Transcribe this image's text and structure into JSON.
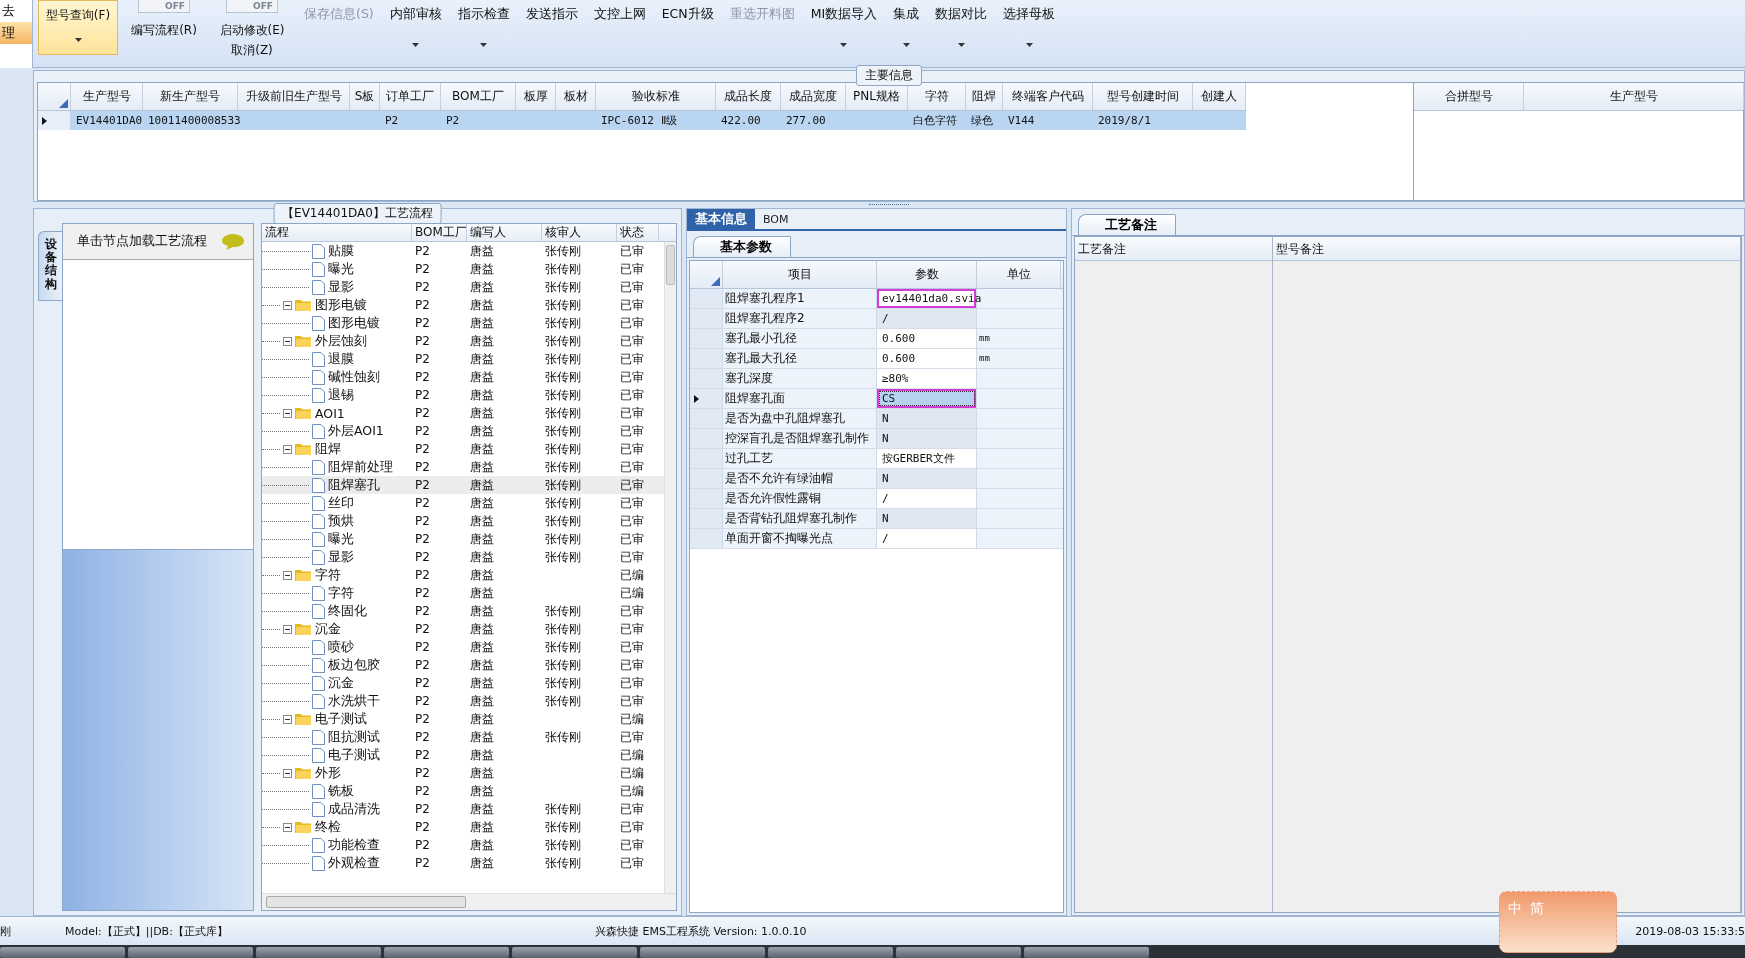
{
  "sidebar": {
    "items": [
      {
        "label": "去",
        "selected": false
      },
      {
        "label": "理",
        "selected": true
      }
    ]
  },
  "toolbar": {
    "items": [
      {
        "kind": "big",
        "label": "型号查询(F)",
        "active": true,
        "dropdown": true
      },
      {
        "kind": "toggle",
        "switch": "OFF",
        "on": false,
        "label": "编写流程(R)"
      },
      {
        "kind": "toggle",
        "switch": "OFF",
        "on": false,
        "label": "启动修改(E)",
        "sublabel": "取消(Z)"
      },
      {
        "kind": "text",
        "label": "保存信息(S)",
        "disabled": true,
        "dropdown": false
      },
      {
        "kind": "text",
        "label": "内部审核",
        "disabled": false,
        "dropdown": true
      },
      {
        "kind": "text",
        "label": "指示检查",
        "disabled": false,
        "dropdown": true
      },
      {
        "kind": "text",
        "label": "发送指示",
        "disabled": false,
        "dropdown": false
      },
      {
        "kind": "text",
        "label": "文控上网",
        "disabled": false,
        "dropdown": false
      },
      {
        "kind": "text",
        "label": "ECN升级",
        "disabled": false,
        "dropdown": false
      },
      {
        "kind": "text",
        "label": "重选开料图",
        "disabled": true,
        "dropdown": false
      },
      {
        "kind": "text",
        "label": "MI数据导入",
        "disabled": false,
        "dropdown": true
      },
      {
        "kind": "text",
        "label": "集成",
        "disabled": false,
        "dropdown": true
      },
      {
        "kind": "text",
        "label": "数据对比",
        "disabled": false,
        "dropdown": true
      },
      {
        "kind": "text",
        "label": "选择母板",
        "disabled": false,
        "dropdown": true
      }
    ]
  },
  "main_info": {
    "title": "主要信息",
    "columns": [
      "生产型号",
      "新生产型号",
      "升级前旧生产型号",
      "S板",
      "订单工厂",
      "BOM工厂",
      "板厚",
      "板材",
      "验收标准",
      "成品长度",
      "成品宽度",
      "PNL规格",
      "字符",
      "阻焊",
      "终端客户代码",
      "型号创建时间",
      "创建人"
    ],
    "rows": [
      {
        "selected": true,
        "cells": [
          "EV14401DA0",
          "10011400008533",
          null,
          null,
          "P2",
          "P2",
          null,
          null,
          "IPC-6012 Ⅱ级",
          "422.00",
          "277.00",
          null,
          "白色字符",
          "绿色",
          "V144",
          "2019/8/1",
          null
        ]
      }
    ],
    "side_columns": [
      "合拼型号",
      "生产型号"
    ]
  },
  "process": {
    "title": "【EV14401DA0】工艺流程",
    "side_tab": "设备结构",
    "hint": "单击节点加载工艺流程",
    "columns": [
      "流程",
      "BOM工厂",
      "编写人",
      "核审人",
      "状态"
    ],
    "nodes": [
      {
        "kind": "leaf",
        "name": "贴膜",
        "bom": "P2",
        "writer": "唐益",
        "reviewer": "张传刚",
        "status": "已审",
        "selected": false
      },
      {
        "kind": "leaf",
        "name": "曝光",
        "bom": "P2",
        "writer": "唐益",
        "reviewer": "张传刚",
        "status": "已审",
        "selected": false
      },
      {
        "kind": "leaf",
        "name": "显影",
        "bom": "P2",
        "writer": "唐益",
        "reviewer": "张传刚",
        "status": "已审",
        "selected": false
      },
      {
        "kind": "folder",
        "name": "图形电镀",
        "bom": "P2",
        "writer": "唐益",
        "reviewer": "张传刚",
        "status": "已审",
        "selected": false,
        "expanded": true,
        "children": [
          {
            "kind": "leaf",
            "name": "图形电镀",
            "bom": "P2",
            "writer": "唐益",
            "reviewer": "张传刚",
            "status": "已审",
            "selected": false
          }
        ]
      },
      {
        "kind": "folder",
        "name": "外层蚀刻",
        "bom": "P2",
        "writer": "唐益",
        "reviewer": "张传刚",
        "status": "已审",
        "selected": false,
        "expanded": true,
        "children": [
          {
            "kind": "leaf",
            "name": "退膜",
            "bom": "P2",
            "writer": "唐益",
            "reviewer": "张传刚",
            "status": "已审",
            "selected": false
          },
          {
            "kind": "leaf",
            "name": "碱性蚀刻",
            "bom": "P2",
            "writer": "唐益",
            "reviewer": "张传刚",
            "status": "已审",
            "selected": false
          },
          {
            "kind": "leaf",
            "name": "退锡",
            "bom": "P2",
            "writer": "唐益",
            "reviewer": "张传刚",
            "status": "已审",
            "selected": false
          }
        ]
      },
      {
        "kind": "folder",
        "name": "AOI1",
        "bom": "P2",
        "writer": "唐益",
        "reviewer": "张传刚",
        "status": "已审",
        "selected": false,
        "expanded": true,
        "children": [
          {
            "kind": "leaf",
            "name": "外层AOI1",
            "bom": "P2",
            "writer": "唐益",
            "reviewer": "张传刚",
            "status": "已审",
            "selected": false
          }
        ]
      },
      {
        "kind": "folder",
        "name": "阻焊",
        "bom": "P2",
        "writer": "唐益",
        "reviewer": "张传刚",
        "status": "已审",
        "selected": false,
        "expanded": true,
        "children": [
          {
            "kind": "leaf",
            "name": "阻焊前处理",
            "bom": "P2",
            "writer": "唐益",
            "reviewer": "张传刚",
            "status": "已审",
            "selected": false
          },
          {
            "kind": "leaf",
            "name": "阻焊塞孔",
            "bom": "P2",
            "writer": "唐益",
            "reviewer": "张传刚",
            "status": "已审",
            "selected": true
          },
          {
            "kind": "leaf",
            "name": "丝印",
            "bom": "P2",
            "writer": "唐益",
            "reviewer": "张传刚",
            "status": "已审",
            "selected": false
          },
          {
            "kind": "leaf",
            "name": "预烘",
            "bom": "P2",
            "writer": "唐益",
            "reviewer": "张传刚",
            "status": "已审",
            "selected": false
          },
          {
            "kind": "leaf",
            "name": "曝光",
            "bom": "P2",
            "writer": "唐益",
            "reviewer": "张传刚",
            "status": "已审",
            "selected": false
          },
          {
            "kind": "leaf",
            "name": "显影",
            "bom": "P2",
            "writer": "唐益",
            "reviewer": "张传刚",
            "status": "已审",
            "selected": false
          }
        ]
      },
      {
        "kind": "folder",
        "name": "字符",
        "bom": "P2",
        "writer": "唐益",
        "status": "已编",
        "selected": false,
        "expanded": true,
        "children": [
          {
            "kind": "leaf",
            "name": "字符",
            "bom": "P2",
            "writer": "唐益",
            "status": "已编",
            "selected": false
          },
          {
            "kind": "leaf",
            "name": "终固化",
            "bom": "P2",
            "writer": "唐益",
            "reviewer": "张传刚",
            "status": "已审",
            "selected": false
          }
        ]
      },
      {
        "kind": "folder",
        "name": "沉金",
        "bom": "P2",
        "writer": "唐益",
        "reviewer": "张传刚",
        "status": "已审",
        "selected": false,
        "expanded": true,
        "children": [
          {
            "kind": "leaf",
            "name": "喷砂",
            "bom": "P2",
            "writer": "唐益",
            "reviewer": "张传刚",
            "status": "已审",
            "selected": false
          },
          {
            "kind": "leaf",
            "name": "板边包胶",
            "bom": "P2",
            "writer": "唐益",
            "reviewer": "张传刚",
            "status": "已审",
            "selected": false
          },
          {
            "kind": "leaf",
            "name": "沉金",
            "bom": "P2",
            "writer": "唐益",
            "reviewer": "张传刚",
            "status": "已审",
            "selected": false
          },
          {
            "kind": "leaf",
            "name": "水洗烘干",
            "bom": "P2",
            "writer": "唐益",
            "reviewer": "张传刚",
            "status": "已审",
            "selected": false
          }
        ]
      },
      {
        "kind": "folder",
        "name": "电子测试",
        "bom": "P2",
        "writer": "唐益",
        "status": "已编",
        "selected": false,
        "expanded": true,
        "children": [
          {
            "kind": "leaf",
            "name": "阻抗测试",
            "bom": "P2",
            "writer": "唐益",
            "reviewer": "张传刚",
            "status": "已审",
            "selected": false
          },
          {
            "kind": "leaf",
            "name": "电子测试",
            "bom": "P2",
            "writer": "唐益",
            "status": "已编",
            "selected": false
          }
        ]
      },
      {
        "kind": "folder",
        "name": "外形",
        "bom": "P2",
        "writer": "唐益",
        "status": "已编",
        "selected": false,
        "expanded": true,
        "children": [
          {
            "kind": "leaf",
            "name": "铣板",
            "bom": "P2",
            "writer": "唐益",
            "status": "已编",
            "selected": false
          },
          {
            "kind": "leaf",
            "name": "成品清洗",
            "bom": "P2",
            "writer": "唐益",
            "reviewer": "张传刚",
            "status": "已审",
            "selected": false
          }
        ]
      },
      {
        "kind": "folder",
        "name": "终检",
        "bom": "P2",
        "writer": "唐益",
        "reviewer": "张传刚",
        "status": "已审",
        "selected": false,
        "expanded": true,
        "children": [
          {
            "kind": "leaf",
            "name": "功能检查",
            "bom": "P2",
            "writer": "唐益",
            "reviewer": "张传刚",
            "status": "已审",
            "selected": false
          },
          {
            "kind": "leaf",
            "name": "外观检查",
            "bom": "P2",
            "writer": "唐益",
            "reviewer": "张传刚",
            "status": "已审",
            "selected": false
          }
        ]
      }
    ]
  },
  "params": {
    "tabs": [
      {
        "label": "基本信息",
        "selected": true
      },
      {
        "label": "BOM",
        "selected": false
      }
    ],
    "subtab": "基本参数",
    "columns": [
      "项目",
      "参数",
      "单位"
    ],
    "rows": [
      {
        "item": "阻焊塞孔程序1",
        "value": "ev14401da0.svia",
        "selected": false,
        "editable": true,
        "highlighted": true
      },
      {
        "item": "阻焊塞孔程序2",
        "value": "/",
        "selected": false,
        "editable": false,
        "highlighted": false
      },
      {
        "item": "塞孔最小孔径",
        "value": "0.600",
        "unit": "mm",
        "selected": false,
        "editable": true,
        "highlighted": false
      },
      {
        "item": "塞孔最大孔径",
        "value": "0.600",
        "unit": "mm",
        "selected": false,
        "editable": true,
        "highlighted": false
      },
      {
        "item": "塞孔深度",
        "value": "≥80%",
        "selected": false,
        "editable": true,
        "highlighted": false
      },
      {
        "item": "阻焊塞孔面",
        "value": "CS",
        "selected": true,
        "editable": true,
        "highlighted": true
      },
      {
        "item": "是否为盘中孔阻焊塞孔",
        "value": "N",
        "selected": false,
        "editable": false,
        "highlighted": false
      },
      {
        "item": "控深盲孔是否阻焊塞孔制作",
        "value": "N",
        "selected": false,
        "editable": false,
        "highlighted": false
      },
      {
        "item": "过孔工艺",
        "value": "按GERBER文件",
        "selected": false,
        "editable": true,
        "highlighted": false
      },
      {
        "item": "是否不允许有绿油帽",
        "value": "N",
        "selected": false,
        "editable": false,
        "highlighted": false
      },
      {
        "item": "是否允许假性露铜",
        "value": "/",
        "selected": false,
        "editable": true,
        "highlighted": false
      },
      {
        "item": "是否背钻孔阻焊塞孔制作",
        "value": "N",
        "selected": false,
        "editable": false,
        "highlighted": false
      },
      {
        "item": "单面开窗不掏曝光点",
        "value": "/",
        "selected": false,
        "editable": true,
        "highlighted": false
      }
    ]
  },
  "notes": {
    "tab": "工艺备注",
    "columns": [
      "工艺备注",
      "型号备注"
    ]
  },
  "status_bar": {
    "user": "刚",
    "model": "Model:【正式】||DB:【正式库】",
    "app": "兴森快捷 EMS工程系统 Version: 1.0.0.10",
    "time": "2019-08-03 15:33:5"
  },
  "ime": {
    "labels": [
      "中",
      "简"
    ]
  }
}
